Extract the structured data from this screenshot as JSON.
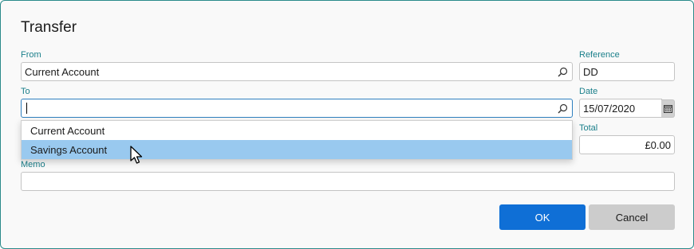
{
  "dialog": {
    "title": "Transfer",
    "from": {
      "label": "From",
      "value": "Current Account"
    },
    "to": {
      "label": "To",
      "value": ""
    },
    "reference": {
      "label": "Reference",
      "value": "DD"
    },
    "date": {
      "label": "Date",
      "value": "15/07/2020"
    },
    "total": {
      "label": "Total",
      "value": "£0.00"
    },
    "memo": {
      "label": "Memo",
      "value": ""
    },
    "dropdown": {
      "items": [
        {
          "label": "Current Account",
          "highlighted": false
        },
        {
          "label": "Savings Account",
          "highlighted": true
        }
      ]
    },
    "buttons": {
      "ok": "OK",
      "cancel": "Cancel"
    }
  },
  "icons": {
    "search": "search-icon",
    "calendar": "calendar-icon",
    "cursor": "mouse-pointer-icon"
  },
  "colors": {
    "label": "#1a7f8a",
    "ok_button": "#0f6fd6",
    "highlight": "#99c9ef",
    "focus_border": "#2e7fbf"
  }
}
